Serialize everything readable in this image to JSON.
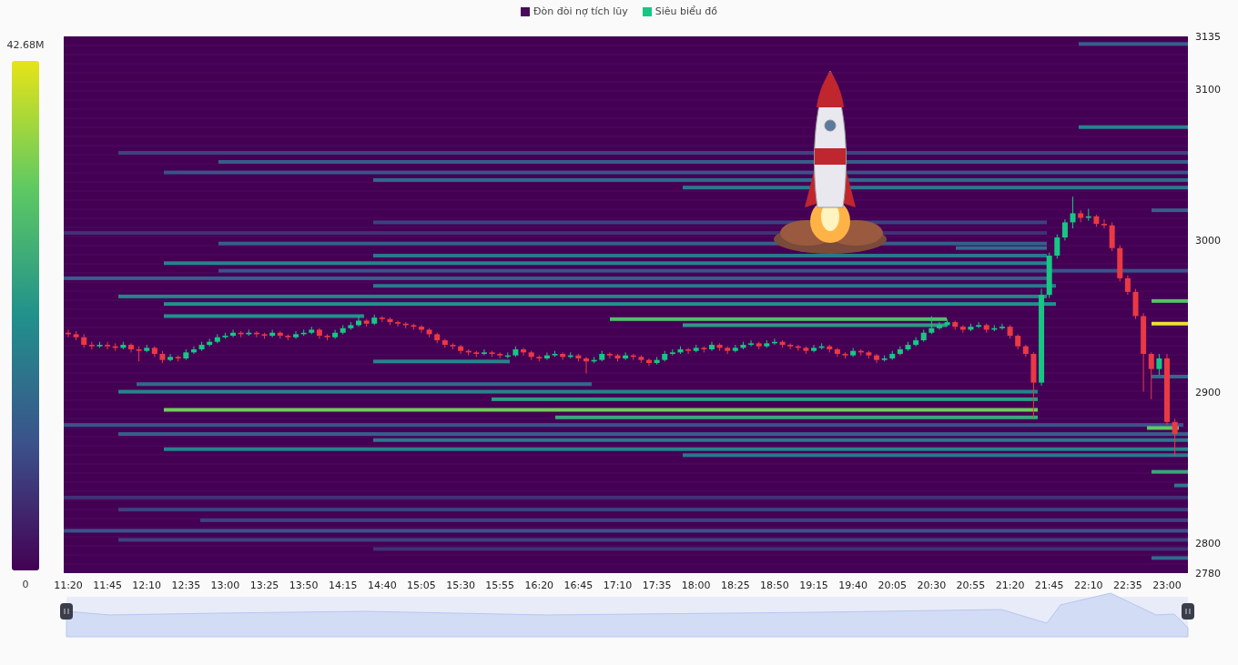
{
  "legend": [
    {
      "label": "Đòn đòi nợ tích lũy",
      "color": "#4a0a5c"
    },
    {
      "label": "Siêu biểu đồ",
      "color": "#16c784"
    }
  ],
  "color_scale": {
    "max_label": "42.68M",
    "min_label": "0"
  },
  "chart_data": {
    "type": "candlestick",
    "ylim": [
      2780,
      3135
    ],
    "yticks": [
      3135,
      3100,
      3000,
      2900,
      2800,
      2780
    ],
    "categories": [
      "11:20",
      null,
      null,
      null,
      null,
      "11:45",
      null,
      null,
      null,
      null,
      "12:10",
      null,
      null,
      null,
      null,
      "12:35",
      null,
      null,
      null,
      null,
      "13:00",
      null,
      null,
      null,
      null,
      "13:25",
      null,
      null,
      null,
      null,
      "13:50",
      null,
      null,
      null,
      null,
      "14:15",
      null,
      null,
      null,
      null,
      "14:40",
      null,
      null,
      null,
      null,
      "15:05",
      null,
      null,
      null,
      null,
      "15:30",
      null,
      null,
      null,
      null,
      "15:55",
      null,
      null,
      null,
      null,
      "16:20",
      null,
      null,
      null,
      null,
      "16:45",
      null,
      null,
      null,
      null,
      "17:10",
      null,
      null,
      null,
      null,
      "17:35",
      null,
      null,
      null,
      null,
      "18:00",
      null,
      null,
      null,
      null,
      "18:25",
      null,
      null,
      null,
      null,
      "18:50",
      null,
      null,
      null,
      null,
      "19:15",
      null,
      null,
      null,
      null,
      "19:40",
      null,
      null,
      null,
      null,
      "20:05",
      null,
      null,
      null,
      null,
      "20:30",
      null,
      null,
      null,
      null,
      "20:55",
      null,
      null,
      null,
      null,
      "21:20",
      null,
      null,
      null,
      null,
      "21:45",
      null,
      null,
      null,
      null,
      "22:10",
      null,
      null,
      null,
      null,
      "22:35",
      null,
      null,
      null,
      null,
      "23:00",
      null
    ],
    "ohlc": [
      [
        2939,
        2941,
        2936,
        2938
      ],
      [
        2938,
        2940,
        2934,
        2936
      ],
      [
        2936,
        2938,
        2929,
        2931
      ],
      [
        2931,
        2933,
        2928,
        2930
      ],
      [
        2930,
        2933,
        2929,
        2931
      ],
      [
        2931,
        2933,
        2928,
        2930
      ],
      [
        2930,
        2932,
        2927,
        2929
      ],
      [
        2929,
        2933,
        2928,
        2931
      ],
      [
        2931,
        2932,
        2926,
        2928
      ],
      [
        2928,
        2930,
        2920,
        2927
      ],
      [
        2927,
        2931,
        2926,
        2929
      ],
      [
        2929,
        2930,
        2923,
        2925
      ],
      [
        2925,
        2927,
        2919,
        2921
      ],
      [
        2921,
        2925,
        2920,
        2923
      ],
      [
        2923,
        2924,
        2920,
        2922
      ],
      [
        2922,
        2928,
        2921,
        2926
      ],
      [
        2926,
        2930,
        2925,
        2928
      ],
      [
        2928,
        2933,
        2927,
        2931
      ],
      [
        2931,
        2935,
        2930,
        2933
      ],
      [
        2933,
        2938,
        2932,
        2936
      ],
      [
        2936,
        2939,
        2935,
        2937
      ],
      [
        2937,
        2941,
        2936,
        2939
      ],
      [
        2939,
        2940,
        2936,
        2938
      ],
      [
        2938,
        2941,
        2937,
        2939
      ],
      [
        2939,
        2940,
        2936,
        2938
      ],
      [
        2938,
        2939,
        2935,
        2937
      ],
      [
        2937,
        2941,
        2936,
        2939
      ],
      [
        2939,
        2940,
        2935,
        2937
      ],
      [
        2937,
        2938,
        2934,
        2936
      ],
      [
        2936,
        2940,
        2935,
        2938
      ],
      [
        2938,
        2941,
        2937,
        2939
      ],
      [
        2939,
        2943,
        2938,
        2941
      ],
      [
        2941,
        2942,
        2935,
        2937
      ],
      [
        2937,
        2938,
        2934,
        2936
      ],
      [
        2936,
        2941,
        2935,
        2939
      ],
      [
        2939,
        2944,
        2938,
        2942
      ],
      [
        2942,
        2946,
        2941,
        2944
      ],
      [
        2944,
        2950,
        2943,
        2947
      ],
      [
        2947,
        2948,
        2943,
        2945
      ],
      [
        2945,
        2951,
        2944,
        2949
      ],
      [
        2949,
        2950,
        2946,
        2948
      ],
      [
        2948,
        2949,
        2944,
        2946
      ],
      [
        2946,
        2947,
        2943,
        2945
      ],
      [
        2945,
        2946,
        2942,
        2944
      ],
      [
        2944,
        2945,
        2941,
        2943
      ],
      [
        2943,
        2944,
        2939,
        2941
      ],
      [
        2941,
        2942,
        2936,
        2938
      ],
      [
        2938,
        2939,
        2932,
        2934
      ],
      [
        2934,
        2935,
        2929,
        2931
      ],
      [
        2931,
        2932,
        2928,
        2930
      ],
      [
        2930,
        2931,
        2925,
        2927
      ],
      [
        2927,
        2928,
        2924,
        2926
      ],
      [
        2926,
        2927,
        2923,
        2925
      ],
      [
        2925,
        2928,
        2924,
        2926
      ],
      [
        2926,
        2927,
        2923,
        2925
      ],
      [
        2925,
        2926,
        2922,
        2924
      ],
      [
        2924,
        2926,
        2922,
        2924
      ],
      [
        2924,
        2930,
        2923,
        2928
      ],
      [
        2928,
        2929,
        2924,
        2926
      ],
      [
        2926,
        2927,
        2921,
        2923
      ],
      [
        2923,
        2924,
        2920,
        2922
      ],
      [
        2922,
        2926,
        2921,
        2924
      ],
      [
        2924,
        2927,
        2923,
        2925
      ],
      [
        2925,
        2926,
        2921,
        2923
      ],
      [
        2923,
        2926,
        2922,
        2924
      ],
      [
        2924,
        2925,
        2920,
        2922
      ],
      [
        2922,
        2923,
        2912,
        2920
      ],
      [
        2920,
        2923,
        2919,
        2921
      ],
      [
        2921,
        2927,
        2920,
        2925
      ],
      [
        2925,
        2926,
        2922,
        2924
      ],
      [
        2924,
        2925,
        2920,
        2922
      ],
      [
        2922,
        2926,
        2921,
        2924
      ],
      [
        2924,
        2925,
        2921,
        2923
      ],
      [
        2923,
        2924,
        2919,
        2921
      ],
      [
        2921,
        2922,
        2917,
        2919
      ],
      [
        2919,
        2923,
        2918,
        2921
      ],
      [
        2921,
        2927,
        2920,
        2925
      ],
      [
        2925,
        2928,
        2924,
        2926
      ],
      [
        2926,
        2930,
        2925,
        2928
      ],
      [
        2928,
        2929,
        2925,
        2927
      ],
      [
        2927,
        2931,
        2926,
        2929
      ],
      [
        2929,
        2930,
        2926,
        2928
      ],
      [
        2928,
        2933,
        2927,
        2931
      ],
      [
        2931,
        2932,
        2927,
        2929
      ],
      [
        2929,
        2930,
        2925,
        2927
      ],
      [
        2927,
        2931,
        2926,
        2929
      ],
      [
        2929,
        2933,
        2928,
        2931
      ],
      [
        2931,
        2934,
        2930,
        2932
      ],
      [
        2932,
        2933,
        2928,
        2930
      ],
      [
        2930,
        2934,
        2929,
        2932
      ],
      [
        2932,
        2935,
        2931,
        2933
      ],
      [
        2933,
        2934,
        2929,
        2931
      ],
      [
        2931,
        2932,
        2928,
        2930
      ],
      [
        2930,
        2931,
        2927,
        2929
      ],
      [
        2929,
        2930,
        2925,
        2927
      ],
      [
        2927,
        2931,
        2926,
        2929
      ],
      [
        2929,
        2932,
        2928,
        2930
      ],
      [
        2930,
        2931,
        2926,
        2928
      ],
      [
        2928,
        2929,
        2923,
        2925
      ],
      [
        2925,
        2926,
        2922,
        2924
      ],
      [
        2924,
        2929,
        2923,
        2927
      ],
      [
        2927,
        2928,
        2924,
        2926
      ],
      [
        2926,
        2927,
        2922,
        2924
      ],
      [
        2924,
        2925,
        2919,
        2921
      ],
      [
        2921,
        2924,
        2920,
        2922
      ],
      [
        2922,
        2927,
        2921,
        2925
      ],
      [
        2925,
        2930,
        2924,
        2928
      ],
      [
        2928,
        2933,
        2927,
        2931
      ],
      [
        2931,
        2936,
        2930,
        2934
      ],
      [
        2934,
        2941,
        2933,
        2939
      ],
      [
        2939,
        2950,
        2938,
        2942
      ],
      [
        2942,
        2946,
        2941,
        2944
      ],
      [
        2944,
        2948,
        2943,
        2946
      ],
      [
        2946,
        2947,
        2941,
        2943
      ],
      [
        2943,
        2944,
        2939,
        2941
      ],
      [
        2941,
        2945,
        2940,
        2943
      ],
      [
        2943,
        2946,
        2942,
        2944
      ],
      [
        2944,
        2945,
        2939,
        2941
      ],
      [
        2941,
        2944,
        2940,
        2942
      ],
      [
        2942,
        2945,
        2941,
        2943
      ],
      [
        2943,
        2944,
        2935,
        2937
      ],
      [
        2937,
        2938,
        2928,
        2930
      ],
      [
        2930,
        2931,
        2923,
        2925
      ],
      [
        2925,
        2926,
        2883,
        2906
      ],
      [
        2906,
        2968,
        2904,
        2964
      ],
      [
        2964,
        2992,
        2962,
        2990
      ],
      [
        2990,
        3004,
        2988,
        3002
      ],
      [
        3002,
        3014,
        3000,
        3012
      ],
      [
        3012,
        3029,
        3008,
        3018
      ],
      [
        3018,
        3020,
        3012,
        3015
      ],
      [
        3015,
        3021,
        3013,
        3016
      ],
      [
        3016,
        3017,
        3009,
        3011
      ],
      [
        3011,
        3014,
        3008,
        3010
      ],
      [
        3010,
        3012,
        2993,
        2995
      ],
      [
        2995,
        2997,
        2973,
        2975
      ],
      [
        2975,
        2977,
        2964,
        2966
      ],
      [
        2966,
        2968,
        2948,
        2950
      ],
      [
        2950,
        2952,
        2900,
        2925
      ],
      [
        2925,
        2926,
        2895,
        2915
      ],
      [
        2915,
        2925,
        2911,
        2922
      ],
      [
        2922,
        2925,
        2878,
        2880
      ],
      [
        2880,
        2882,
        2857,
        2872
      ]
    ]
  }
}
